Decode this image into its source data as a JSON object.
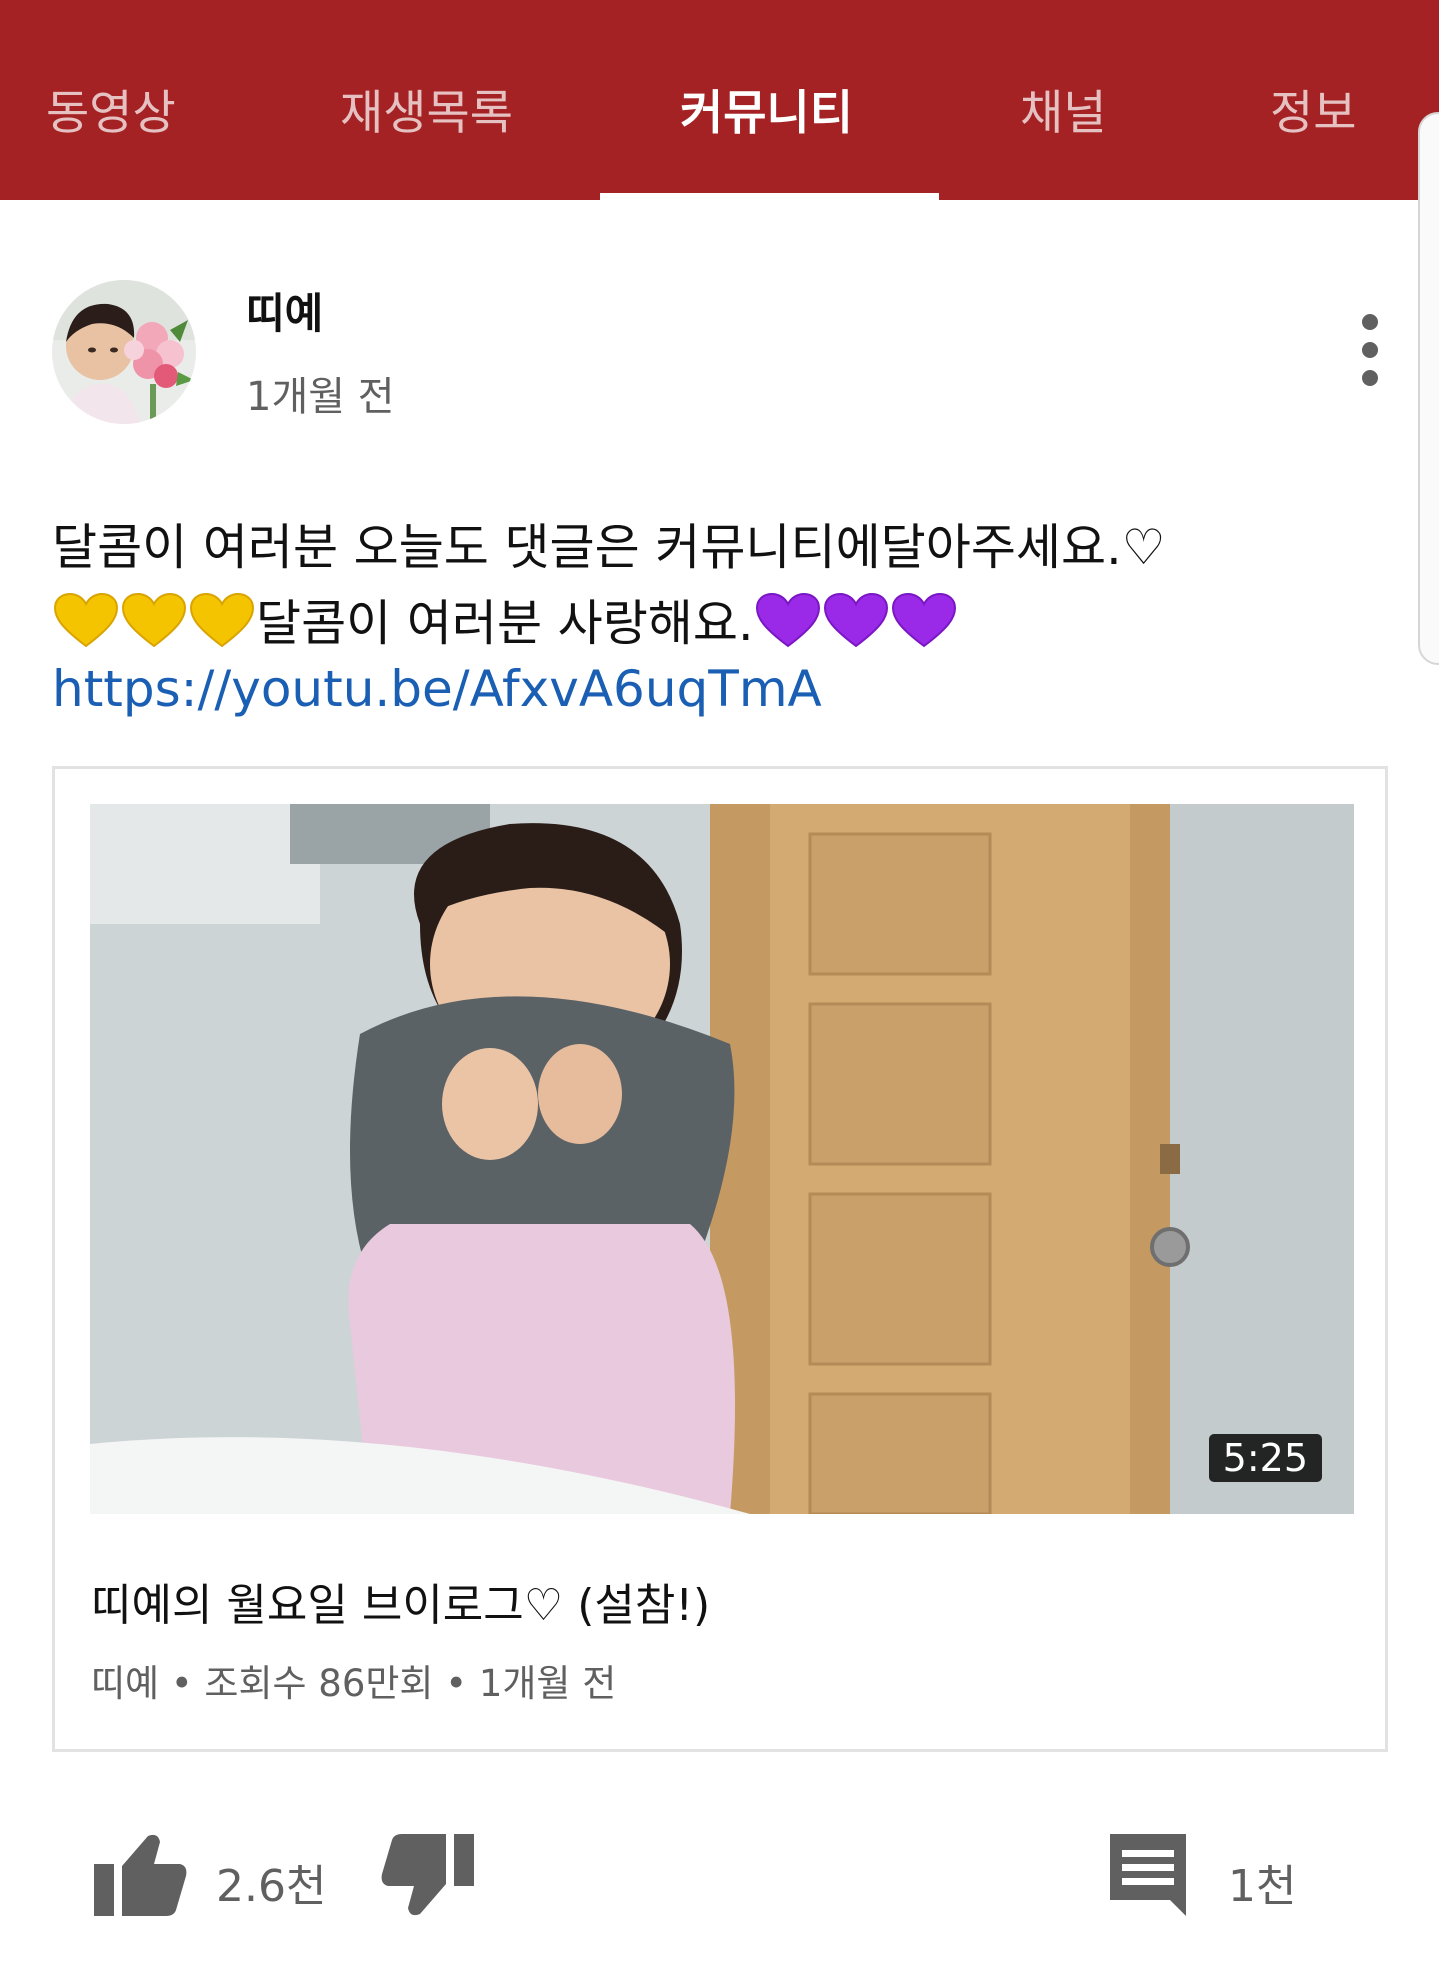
{
  "tabs": [
    {
      "label": "동영상"
    },
    {
      "label": "재생목록"
    },
    {
      "label": "커뮤니티"
    },
    {
      "label": "채널"
    },
    {
      "label": "정보"
    }
  ],
  "active_tab": "커뮤니티",
  "post": {
    "author": "띠예",
    "time": "1개월 전",
    "text_line1": "달콤이 여러분 오늘도 댓글은 커뮤니티에달아주세요.♡",
    "text_line2": "달콤이 여러분 사랑해요.",
    "link": "https://youtu.be/AfxvA6uqTmA"
  },
  "video": {
    "duration": "5:25",
    "title": "띠예의 월요일 브이로그♡ (설참!)",
    "meta": "띠예 • 조회수 86만회 • 1개월 전"
  },
  "actions": {
    "like_count": "2.6천",
    "comment_count": "1천"
  },
  "colors": {
    "header_bg": "#a52224",
    "link": "#1a5fb4",
    "yellow_heart": "#f5c400",
    "purple_heart": "#9b2ae8"
  },
  "icons": [
    "thumbs-up-icon",
    "thumbs-down-icon",
    "comment-icon",
    "more-vert-icon",
    "yellow-heart-icon",
    "purple-heart-icon"
  ]
}
